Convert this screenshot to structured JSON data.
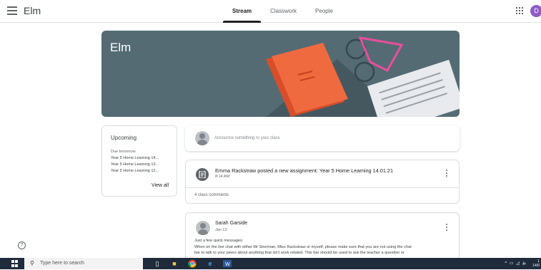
{
  "header": {
    "class_name": "Elm",
    "tabs": [
      "Stream",
      "Classwork",
      "People"
    ],
    "active_tab": "Stream",
    "avatar_letter": "D"
  },
  "banner": {
    "title": "Elm"
  },
  "upcoming": {
    "title": "Upcoming",
    "due_label": "Due tomorrow",
    "items": [
      "Year 5 Home Learning 14...",
      "Year 5 Home Learning 13...",
      "Year 5 Home Learning 12..."
    ],
    "view_all": "View all"
  },
  "announce": {
    "placeholder": "Announce something to your class"
  },
  "assignment_post": {
    "title": "Emma Rackstraw posted a new assignment: Year 5 Home Learning 14.01.21",
    "time": "8:14 AM",
    "comments": "4 class comments"
  },
  "message_post": {
    "author": "Sarah Garside",
    "date": "Jan 13",
    "line1": "Just a few quick messages:",
    "line2": "When on the live chat with either Mr Sherman, Miss Rackstraw or myself, please make sure that you are not using the chat",
    "line3": "bar to talk to your peers about anything that isn't work related. This bar should be used to ask the teacher a question or"
  },
  "taskbar": {
    "search_placeholder": "Type here to search",
    "clock_time": "1",
    "clock_date": "14/0"
  },
  "colors": {
    "banner": "#546b73",
    "avatar": "#8e5bc9",
    "taskbar": "#1f2b3b"
  }
}
